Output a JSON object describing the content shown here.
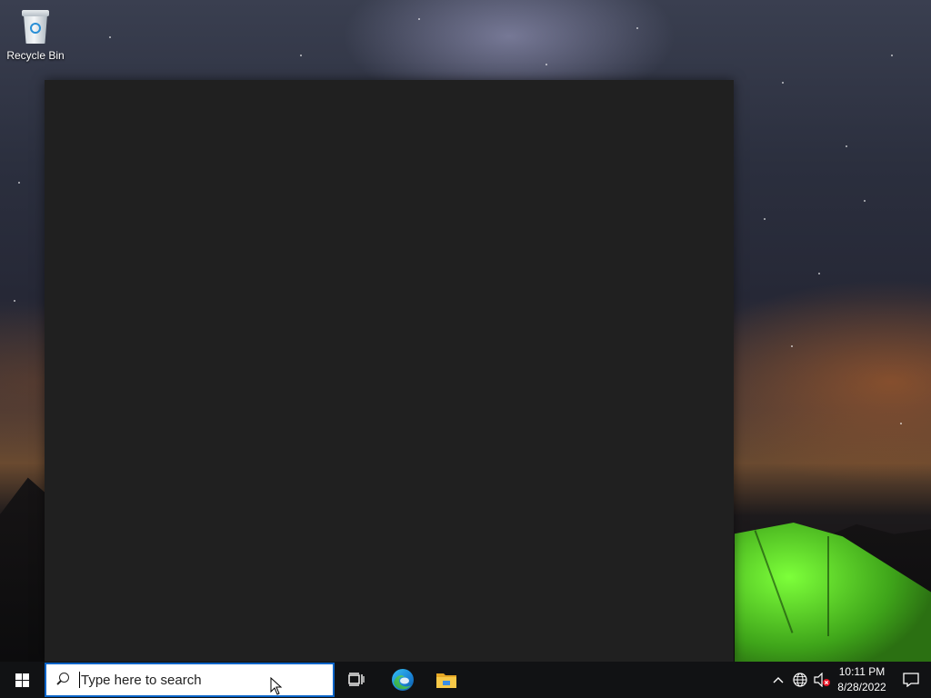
{
  "desktop": {
    "icons": [
      {
        "label": "Recycle Bin",
        "icon": "recycle-bin-icon"
      }
    ]
  },
  "taskbar": {
    "search": {
      "placeholder": "Type here to search"
    },
    "pinned": [
      {
        "name": "task-view",
        "icon": "task-view-icon"
      },
      {
        "name": "edge",
        "icon": "edge-icon"
      },
      {
        "name": "file-explorer",
        "icon": "folder-icon"
      }
    ],
    "tray": {
      "time": "10:11 PM",
      "date": "8/28/2022"
    }
  },
  "colors": {
    "panel_background": "#202020",
    "taskbar": "#111214",
    "search_border": "#0a64c8"
  }
}
